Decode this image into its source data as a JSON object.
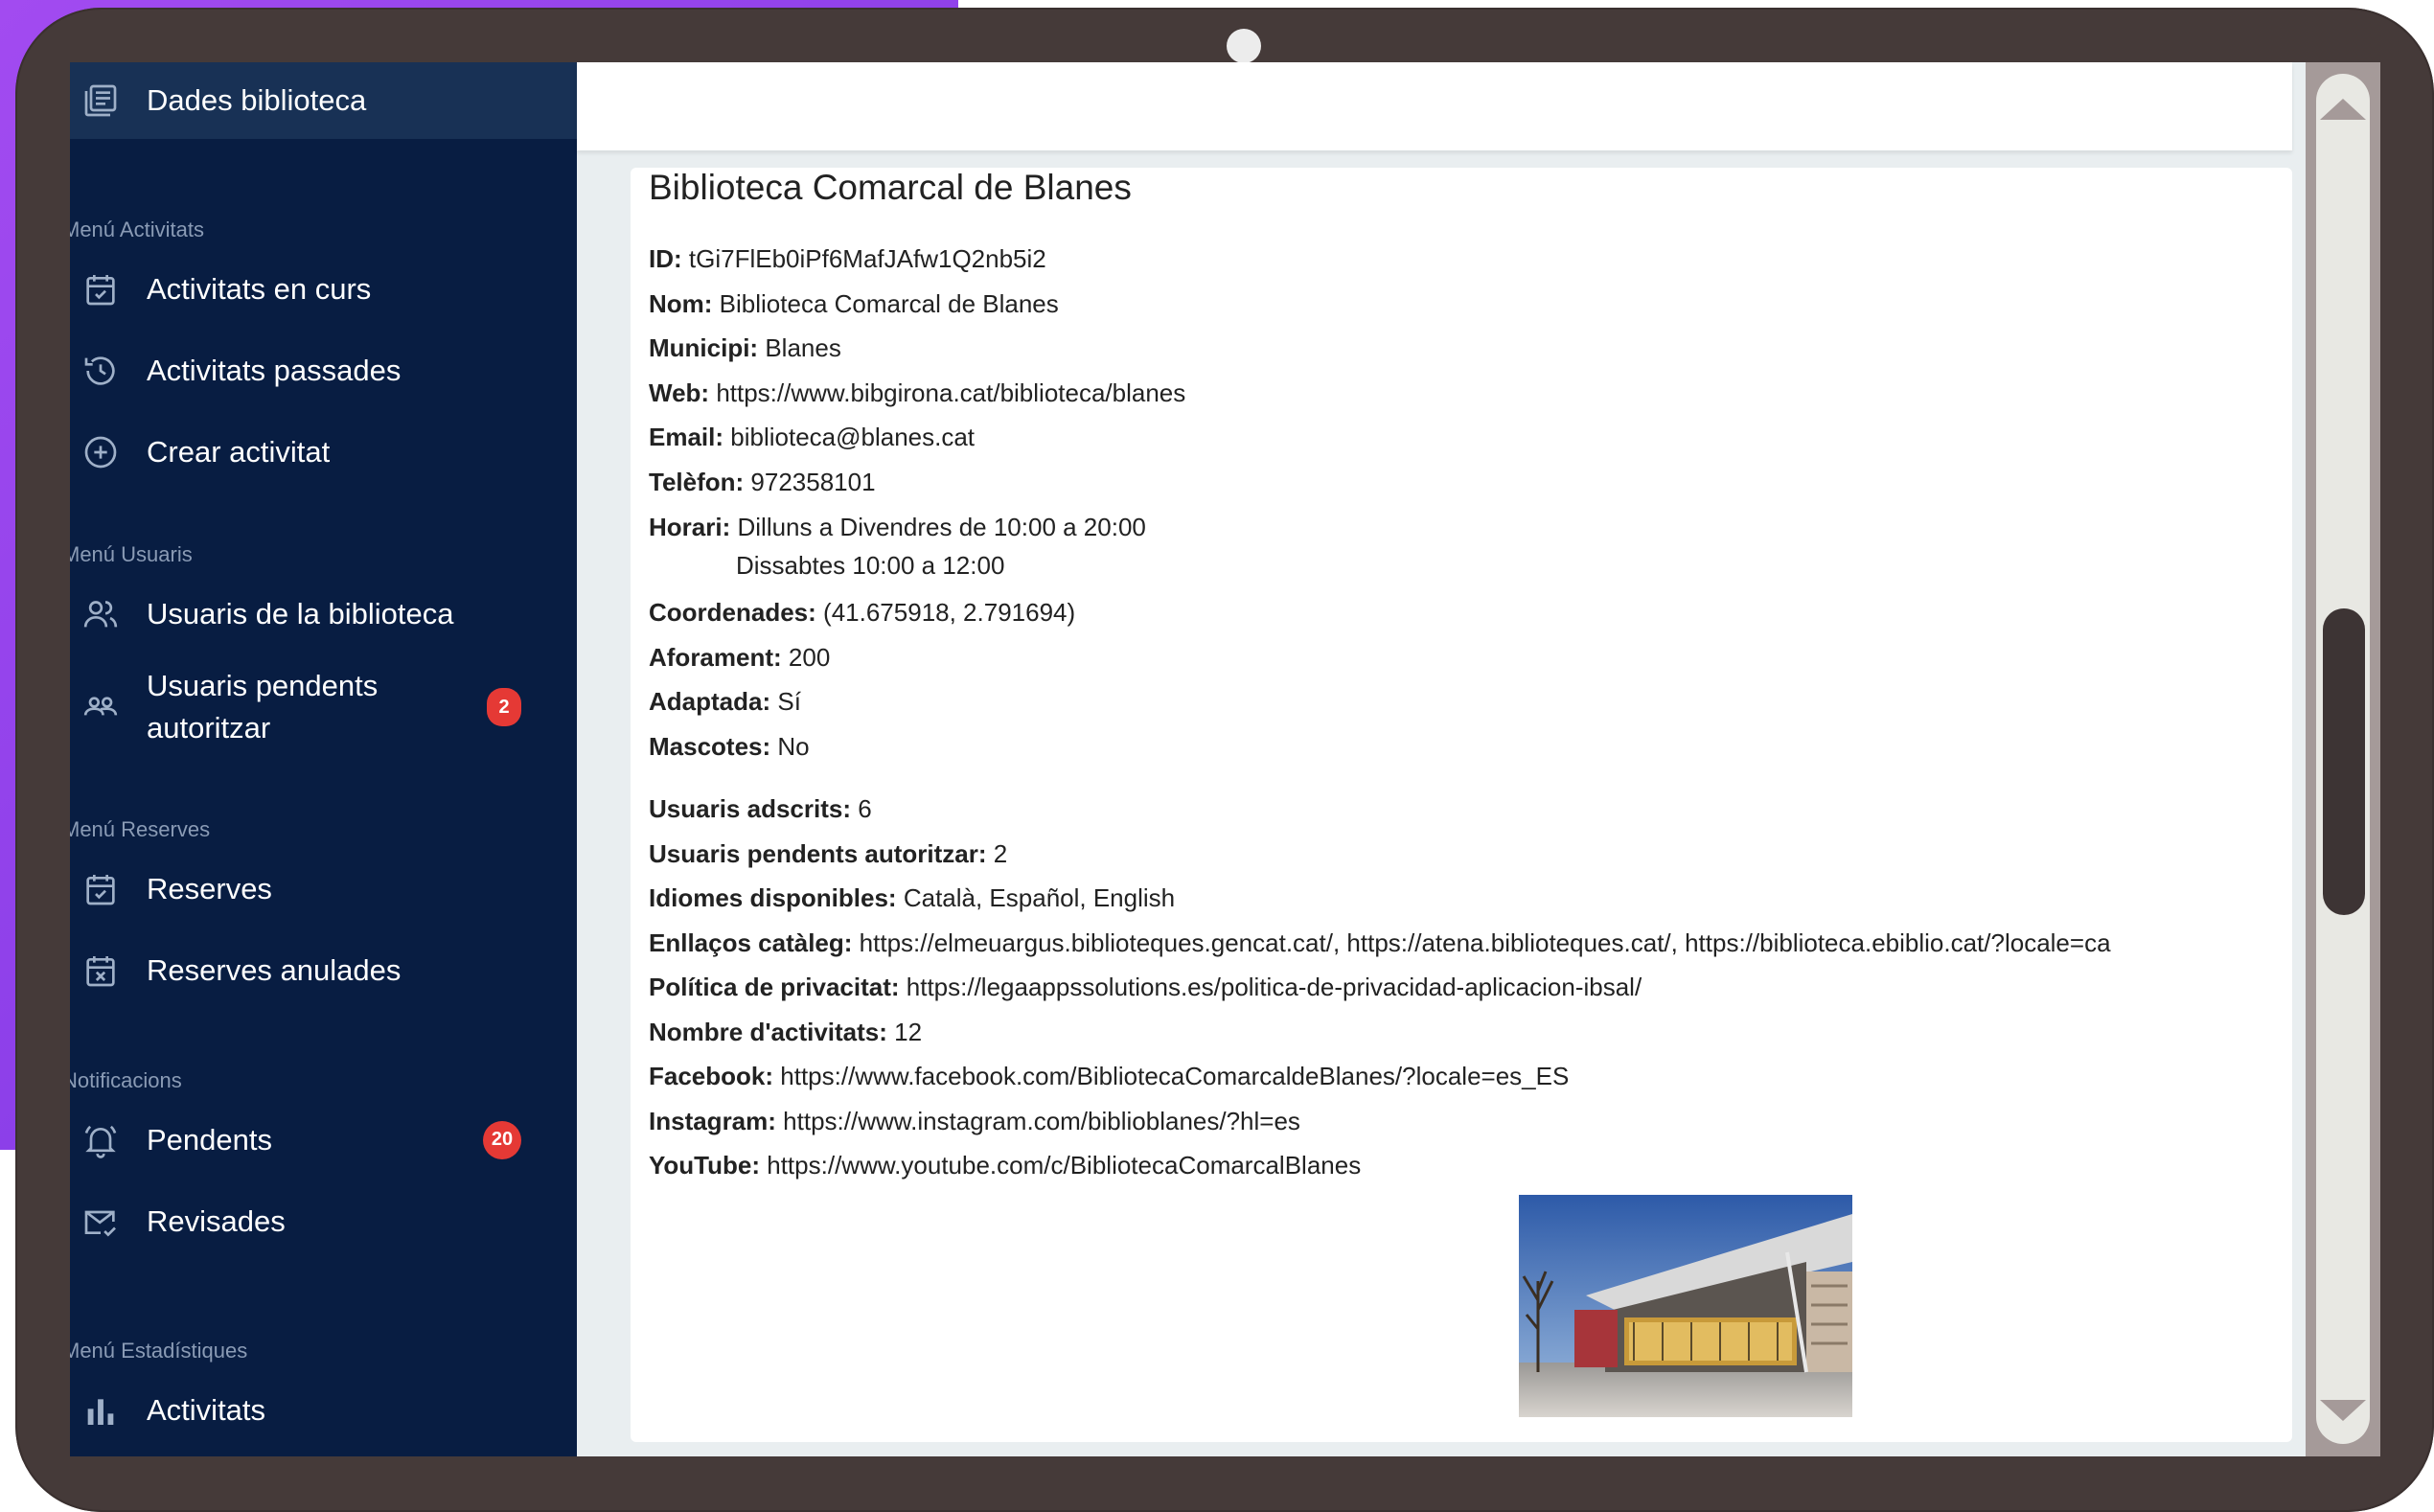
{
  "sidebar": {
    "top_item": {
      "label": "Dades biblioteca",
      "icon": "library-list-icon"
    },
    "sections": [
      {
        "title": "Menú Activitats",
        "items": [
          {
            "label": "Activitats en curs",
            "icon": "calendar-check-icon"
          },
          {
            "label": "Activitats passades",
            "icon": "history-icon"
          },
          {
            "label": "Crear activitat",
            "icon": "add-circle-icon"
          }
        ]
      },
      {
        "title": "Menú Usuaris",
        "items": [
          {
            "label": "Usuaris de la biblioteca",
            "icon": "users-icon"
          },
          {
            "label": "Usuaris pendents autoritzar",
            "icon": "group-icon",
            "badge": "2"
          }
        ]
      },
      {
        "title": "Menú Reserves",
        "items": [
          {
            "label": "Reserves",
            "icon": "calendar-check-icon"
          },
          {
            "label": "Reserves anulades",
            "icon": "calendar-x-icon"
          }
        ]
      },
      {
        "title": "Notificacions",
        "items": [
          {
            "label": "Pendents",
            "icon": "bell-icon",
            "badge": "20"
          },
          {
            "label": "Revisades",
            "icon": "mail-check-icon"
          }
        ]
      },
      {
        "title": "Menú Estadístiques",
        "items": [
          {
            "label": "Activitats",
            "icon": "bar-chart-icon"
          }
        ]
      }
    ]
  },
  "library": {
    "title": "Biblioteca Comarcal de Blanes",
    "fields": {
      "id_label": "ID:",
      "id": "tGi7FlEb0iPf6MafJAfw1Q2nb5i2",
      "nom_label": "Nom:",
      "nom": "Biblioteca Comarcal de Blanes",
      "municipi_label": "Municipi:",
      "municipi": "Blanes",
      "web_label": "Web:",
      "web": "https://www.bibgirona.cat/biblioteca/blanes",
      "email_label": "Email:",
      "email": "biblioteca@blanes.cat",
      "telefon_label": "Telèfon:",
      "telefon": "972358101",
      "horari_label": "Horari:",
      "horari_1": "Dilluns a Divendres de 10:00 a 20:00",
      "horari_2": "Dissabtes 10:00 a 12:00",
      "coord_label": "Coordenades:",
      "coord": "(41.675918, 2.791694)",
      "aforament_label": "Aforament:",
      "aforament": "200",
      "adaptada_label": "Adaptada:",
      "adaptada": "Sí",
      "mascotes_label": "Mascotes:",
      "mascotes": "No",
      "adscrits_label": "Usuaris adscrits:",
      "adscrits": "6",
      "pendents_label": "Usuaris pendents autoritzar:",
      "pendents": "2",
      "idiomes_label": "Idiomes disponibles:",
      "idiomes": "Català, Español, English",
      "enllacos_label": "Enllaços catàleg:",
      "enllacos": "https://elmeuargus.biblioteques.gencat.cat/, https://atena.biblioteques.cat/, https://biblioteca.ebiblio.cat/?locale=ca",
      "politica_label": "Política de privacitat:",
      "politica": "https://legaappssolutions.es/politica-de-privacidad-aplicacion-ibsal/",
      "nombre_label": "Nombre d'activitats:",
      "nombre": "12",
      "facebook_label": "Facebook:",
      "facebook": "https://www.facebook.com/BibliotecaComarcaldeBlanes/?locale=es_ES",
      "instagram_label": "Instagram:",
      "instagram": "https://www.instagram.com/biblioblanes/?hl=es",
      "youtube_label": "YouTube:",
      "youtube": "https://www.youtube.com/c/BibliotecaComarcalBlanes"
    }
  },
  "colors": {
    "sidebar_bg": "#081d42",
    "sidebar_active": "#183155",
    "badge": "#e53935",
    "tablet_frame": "#453a39",
    "accent_purple": "#9b45ee"
  }
}
